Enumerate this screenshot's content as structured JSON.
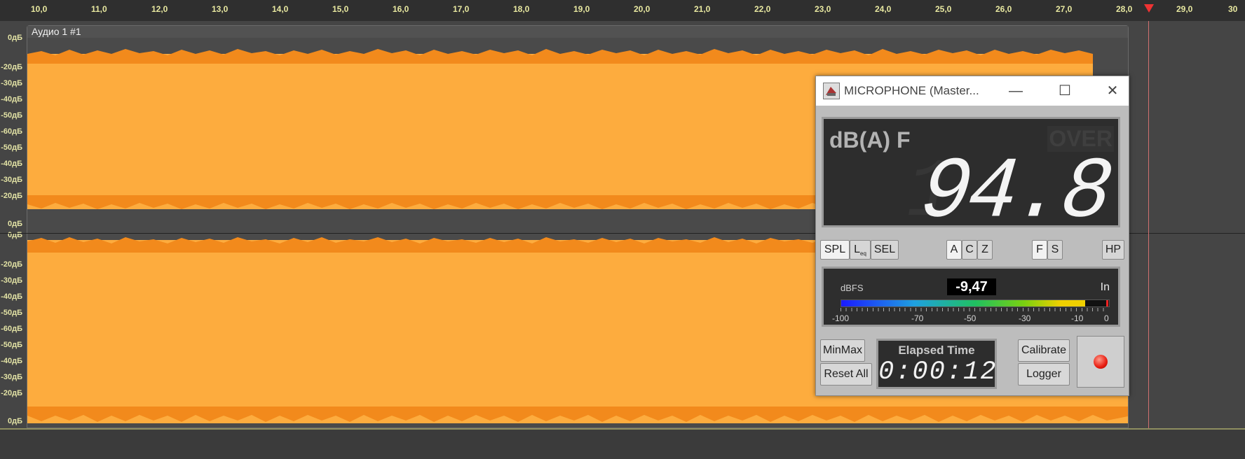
{
  "ruler": {
    "ticks": [
      "10,0",
      "11,0",
      "12,0",
      "13,0",
      "14,0",
      "15,0",
      "16,0",
      "17,0",
      "18,0",
      "19,0",
      "20,0",
      "21,0",
      "22,0",
      "23,0",
      "24,0",
      "25,0",
      "26,0",
      "27,0",
      "28,0",
      "29,0",
      "30"
    ]
  },
  "db_scale": {
    "ch1": [
      "0дБ",
      "-20дБ",
      "-30дБ",
      "-40дБ",
      "-50дБ",
      "-60дБ",
      "-50дБ",
      "-40дБ",
      "-30дБ",
      "-20дБ",
      "0дБ"
    ],
    "ch2": [
      "0дБ",
      "-20дБ",
      "-30дБ",
      "-40дБ",
      "-50дБ",
      "-60дБ",
      "-50дБ",
      "-40дБ",
      "-30дБ",
      "-20дБ",
      "0дБ"
    ]
  },
  "clip": {
    "title": "Аудио 1 #1",
    "color": "#fdac3e"
  },
  "meter_window": {
    "title": "MICROPHONE (Master...",
    "mode_label": "dB(A) F",
    "over_label": "OVER",
    "value": "94.8",
    "buttons": {
      "spl": "SPL",
      "leq": "L",
      "leq_sub": "eq",
      "sel": "SEL",
      "a": "A",
      "c": "C",
      "z": "Z",
      "f": "F",
      "s": "S",
      "hp": "HP"
    },
    "input": {
      "unit": "dBFS",
      "readout": "-9,47",
      "label": "In",
      "level_fraction": 0.91,
      "scale": [
        "-100",
        "-70",
        "-50",
        "-30",
        "-10",
        "0"
      ]
    },
    "minmax": "MinMax",
    "reset_all": "Reset All",
    "elapsed_title": "Elapsed Time",
    "elapsed_value": "0:00:12",
    "calibrate": "Calibrate",
    "logger": "Logger"
  }
}
